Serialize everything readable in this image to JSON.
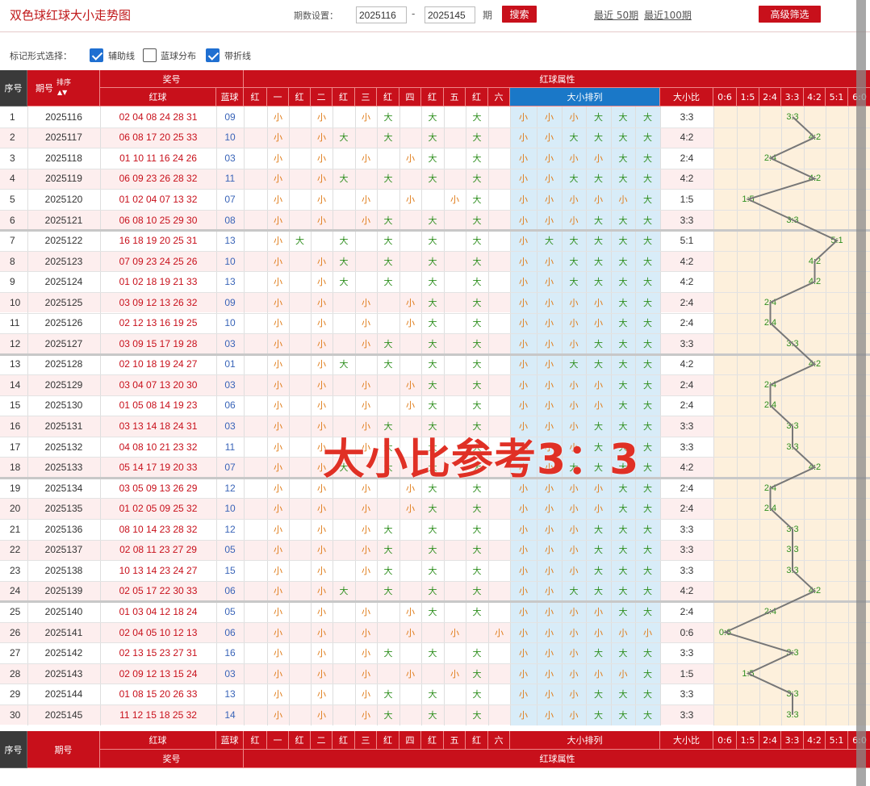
{
  "header": {
    "title": "双色球红球大小走势图",
    "period_label": "期数设置：",
    "start": "2025116",
    "dash": "-",
    "end": "2025145",
    "unit": "期",
    "search": "搜索",
    "recent50": "最近 50期",
    "recent100": "最近100期",
    "advanced": "高级筛选"
  },
  "options": {
    "label": "标记形式选择：",
    "aux": "辅助线",
    "blue": "蓝球分布",
    "fold": "带折线",
    "aux_checked": true,
    "blue_checked": false,
    "fold_checked": true
  },
  "table": {
    "hdr_seq": "序号",
    "hdr_period": "期号",
    "hdr_sort": "排序",
    "hdr_award": "奖号",
    "hdr_red": "红球",
    "hdr_blue": "蓝球",
    "hdr_attr": "红球属性",
    "pos_headers": [
      "红",
      "一",
      "红",
      "二",
      "红",
      "三",
      "红",
      "四",
      "红",
      "五",
      "红",
      "六"
    ],
    "hdr_arr": "大小排列",
    "hdr_ratio": "大小比",
    "ratio_headers": [
      "0:6",
      "1:5",
      "2:4",
      "3:3",
      "4:2",
      "5:1",
      "6:0"
    ],
    "big": "大",
    "small": "小",
    "rows": [
      {
        "seq": "1",
        "period": "2025116",
        "red": "02 04 08 24 28 31",
        "blue": "09",
        "ratio": "3:3"
      },
      {
        "seq": "2",
        "period": "2025117",
        "red": "06 08 17 20 25 33",
        "blue": "10",
        "ratio": "4:2"
      },
      {
        "seq": "3",
        "period": "2025118",
        "red": "01 10 11 16 24 26",
        "blue": "03",
        "ratio": "2:4"
      },
      {
        "seq": "4",
        "period": "2025119",
        "red": "06 09 23 26 28 32",
        "blue": "11",
        "ratio": "4:2"
      },
      {
        "seq": "5",
        "period": "2025120",
        "red": "01 02 04 07 13 32",
        "blue": "07",
        "ratio": "1:5"
      },
      {
        "seq": "6",
        "period": "2025121",
        "red": "06 08 10 25 29 30",
        "blue": "08",
        "ratio": "3:3"
      },
      {
        "seq": "7",
        "period": "2025122",
        "red": "16 18 19 20 25 31",
        "blue": "13",
        "ratio": "5:1"
      },
      {
        "seq": "8",
        "period": "2025123",
        "red": "07 09 23 24 25 26",
        "blue": "10",
        "ratio": "4:2"
      },
      {
        "seq": "9",
        "period": "2025124",
        "red": "01 02 18 19 21 33",
        "blue": "13",
        "ratio": "4:2"
      },
      {
        "seq": "10",
        "period": "2025125",
        "red": "03 09 12 13 26 32",
        "blue": "09",
        "ratio": "2:4"
      },
      {
        "seq": "11",
        "period": "2025126",
        "red": "02 12 13 16 19 25",
        "blue": "10",
        "ratio": "2:4"
      },
      {
        "seq": "12",
        "period": "2025127",
        "red": "03 09 15 17 19 28",
        "blue": "03",
        "ratio": "3:3"
      },
      {
        "seq": "13",
        "period": "2025128",
        "red": "02 10 18 19 24 27",
        "blue": "01",
        "ratio": "4:2"
      },
      {
        "seq": "14",
        "period": "2025129",
        "red": "03 04 07 13 20 30",
        "blue": "03",
        "ratio": "2:4"
      },
      {
        "seq": "15",
        "period": "2025130",
        "red": "01 05 08 14 19 23",
        "blue": "06",
        "ratio": "2:4"
      },
      {
        "seq": "16",
        "period": "2025131",
        "red": "03 13 14 18 24 31",
        "blue": "03",
        "ratio": "3:3"
      },
      {
        "seq": "17",
        "period": "2025132",
        "red": "04 08 10 21 23 32",
        "blue": "11",
        "ratio": "3:3"
      },
      {
        "seq": "18",
        "period": "2025133",
        "red": "05 14 17 19 20 33",
        "blue": "07",
        "ratio": "4:2"
      },
      {
        "seq": "19",
        "period": "2025134",
        "red": "03 05 09 13 26 29",
        "blue": "12",
        "ratio": "2:4"
      },
      {
        "seq": "20",
        "period": "2025135",
        "red": "01 02 05 09 25 32",
        "blue": "10",
        "ratio": "2:4"
      },
      {
        "seq": "21",
        "period": "2025136",
        "red": "08 10 14 23 28 32",
        "blue": "12",
        "ratio": "3:3"
      },
      {
        "seq": "22",
        "period": "2025137",
        "red": "02 08 11 23 27 29",
        "blue": "05",
        "ratio": "3:3"
      },
      {
        "seq": "23",
        "period": "2025138",
        "red": "10 13 14 23 24 27",
        "blue": "15",
        "ratio": "3:3"
      },
      {
        "seq": "24",
        "period": "2025139",
        "red": "02 05 17 22 30 33",
        "blue": "06",
        "ratio": "4:2"
      },
      {
        "seq": "25",
        "period": "2025140",
        "red": "01 03 04 12 18 24",
        "blue": "05",
        "ratio": "2:4"
      },
      {
        "seq": "26",
        "period": "2025141",
        "red": "02 04 05 10 12 13",
        "blue": "06",
        "ratio": "0:6"
      },
      {
        "seq": "27",
        "period": "2025142",
        "red": "02 13 15 23 27 31",
        "blue": "16",
        "ratio": "3:3"
      },
      {
        "seq": "28",
        "period": "2025143",
        "red": "02 09 12 13 15 24",
        "blue": "03",
        "ratio": "1:5"
      },
      {
        "seq": "29",
        "period": "2025144",
        "red": "01 08 15 20 26 33",
        "blue": "13",
        "ratio": "3:3"
      },
      {
        "seq": "30",
        "period": "2025145",
        "red": "11 12 15 18 25 32",
        "blue": "14",
        "ratio": "3:3"
      }
    ],
    "footer_seq": "序号",
    "footer_period": "期号",
    "footer_red": "红球",
    "footer_blue": "蓝球",
    "footer_award": "奖号",
    "footer_attr": "红球属性"
  },
  "overlay_text": "大小比参考3：3",
  "colors": {
    "red": "#c8101b",
    "big": "#2f8f1f",
    "small": "#e07b18",
    "blue_text": "#3a64b8",
    "arr_bg": "#d8ecf8",
    "ratio_bg": "#fdf0dc",
    "pink_row": "#fdeeee"
  }
}
